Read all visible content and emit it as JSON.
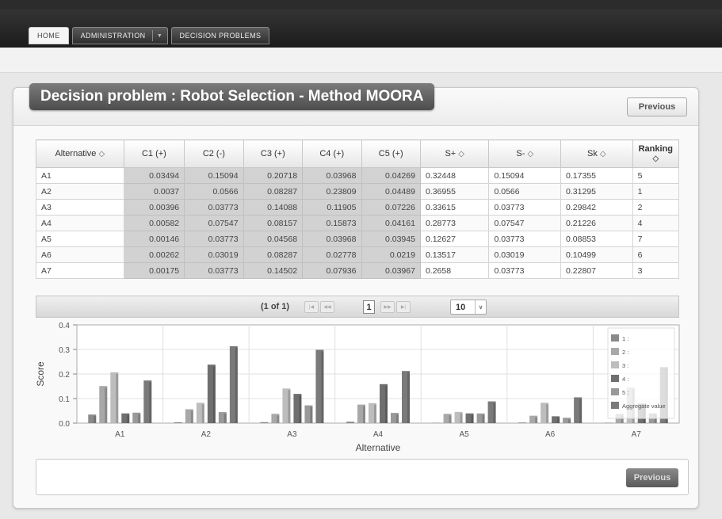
{
  "nav": {
    "home": "HOME",
    "administration": "ADMINISTRATION",
    "administration_arrow": "▼",
    "decision_problems": "DECISION PROBLEMS"
  },
  "panel": {
    "title": "Decision problem : Robot Selection - Method MOORA",
    "previous_top": "Previous",
    "previous_bottom": "Previous"
  },
  "table": {
    "headers": [
      "Alternative",
      "C1 (+)",
      "C2 (-)",
      "C3 (+)",
      "C4 (+)",
      "C5 (+)",
      "S+",
      "S-",
      "Sk",
      "Ranking"
    ],
    "sort_glyph": "◇",
    "rows": [
      [
        "A1",
        "0.03494",
        "0.15094",
        "0.20718",
        "0.03968",
        "0.04269",
        "0.32448",
        "0.15094",
        "0.17355",
        "5"
      ],
      [
        "A2",
        "0.0037",
        "0.0566",
        "0.08287",
        "0.23809",
        "0.04489",
        "0.36955",
        "0.0566",
        "0.31295",
        "1"
      ],
      [
        "A3",
        "0.00396",
        "0.03773",
        "0.14088",
        "0.11905",
        "0.07226",
        "0.33615",
        "0.03773",
        "0.29842",
        "2"
      ],
      [
        "A4",
        "0.00582",
        "0.07547",
        "0.08157",
        "0.15873",
        "0.04161",
        "0.28773",
        "0.07547",
        "0.21226",
        "4"
      ],
      [
        "A5",
        "0.00146",
        "0.03773",
        "0.04568",
        "0.03968",
        "0.03945",
        "0.12627",
        "0.03773",
        "0.08853",
        "7"
      ],
      [
        "A6",
        "0.00262",
        "0.03019",
        "0.08287",
        "0.02778",
        "0.0219",
        "0.13517",
        "0.03019",
        "0.10499",
        "6"
      ],
      [
        "A7",
        "0.00175",
        "0.03773",
        "0.14502",
        "0.07936",
        "0.03967",
        "0.2658",
        "0.03773",
        "0.22807",
        "3"
      ]
    ]
  },
  "paginator": {
    "status": "(1 of 1)",
    "first": "|◀",
    "prev": "◀◀",
    "current_page": "1",
    "next": "▶▶",
    "last": "▶|",
    "rows_per_page": "10",
    "dropdown_glyph": "∨"
  },
  "chart_data": {
    "type": "bar",
    "xlabel": "Alternative",
    "ylabel": "Score",
    "ylim": [
      0,
      0.4
    ],
    "yticks": [
      "0.0",
      "0.1",
      "0.2",
      "0.3",
      "0.4"
    ],
    "categories": [
      "A1",
      "A2",
      "A3",
      "A4",
      "A5",
      "A6",
      "A7"
    ],
    "grid": true,
    "legend_position": "right",
    "series": [
      {
        "name": "1 :",
        "values": [
          0.03494,
          0.0037,
          0.00396,
          0.00582,
          0.00146,
          0.00262,
          0.00175
        ],
        "color": "#8a8a8a"
      },
      {
        "name": "2 :",
        "values": [
          0.15094,
          0.0566,
          0.03773,
          0.07547,
          0.03773,
          0.03019,
          0.03773
        ],
        "color": "#a8a8a8"
      },
      {
        "name": "3 :",
        "values": [
          0.20718,
          0.08287,
          0.14088,
          0.08157,
          0.04568,
          0.08287,
          0.14502
        ],
        "color": "#bdbdbd"
      },
      {
        "name": "4 :",
        "values": [
          0.03968,
          0.23809,
          0.11905,
          0.15873,
          0.03968,
          0.02778,
          0.07936
        ],
        "color": "#6f6f6f"
      },
      {
        "name": "5 :",
        "values": [
          0.04269,
          0.04489,
          0.07226,
          0.04161,
          0.03945,
          0.0219,
          0.03967
        ],
        "color": "#999999"
      },
      {
        "name": "Aggregate value",
        "values": [
          0.17355,
          0.31295,
          0.29842,
          0.21226,
          0.08853,
          0.10499,
          0.22807
        ],
        "color": "#7a7a7a"
      }
    ]
  }
}
